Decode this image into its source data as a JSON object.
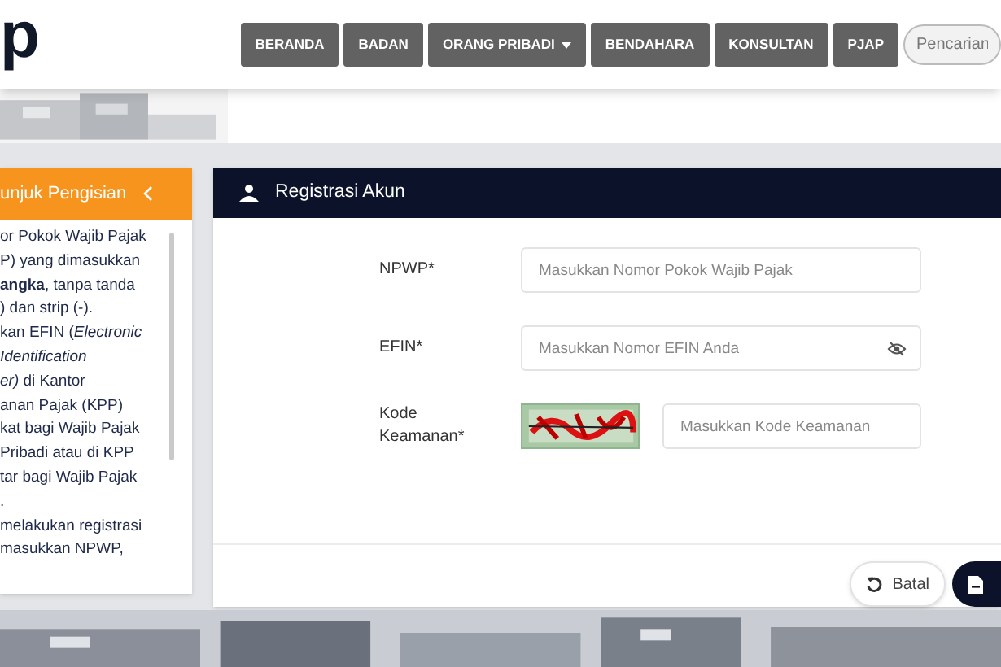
{
  "logo": {
    "text": "p"
  },
  "nav": [
    {
      "label": "BERANDA",
      "dropdown": false
    },
    {
      "label": "BADAN",
      "dropdown": false
    },
    {
      "label": "ORANG PRIBADI",
      "dropdown": true
    },
    {
      "label": "BENDAHARA",
      "dropdown": false
    },
    {
      "label": "KONSULTAN",
      "dropdown": false
    },
    {
      "label": "PJAP",
      "dropdown": false
    }
  ],
  "search": {
    "placeholder": "Pencarian"
  },
  "guide": {
    "title": "unjuk Pengisian",
    "lines": [
      "or Pokok Wajib Pajak",
      "P) yang dimasukkan",
      "**angka**, tanpa tanda",
      ") dan strip (-).",
      "kan EFIN (*Electronic*",
      "*Identification*",
      "*er)* di Kantor",
      "anan Pajak (KPP)",
      "kat bagi Wajib Pajak",
      "Pribadi atau di KPP",
      "tar bagi Wajib Pajak",
      ".",
      "melakukan registrasi",
      "masukkan NPWP,"
    ]
  },
  "form": {
    "title": "Registrasi Akun",
    "fields": [
      {
        "label": "NPWP*",
        "placeholder": "Masukkan Nomor Pokok Wajib Pajak",
        "kind": "text"
      },
      {
        "label": "EFIN*",
        "placeholder": "Masukkan Nomor EFIN Anda",
        "kind": "password"
      },
      {
        "label": "Kode Keamanan*",
        "placeholder": "Masukkan Kode Keamanan",
        "kind": "captcha"
      }
    ],
    "buttons": [
      {
        "label": "Batal",
        "kind": "cancel"
      },
      {
        "kind": "save"
      }
    ]
  }
}
